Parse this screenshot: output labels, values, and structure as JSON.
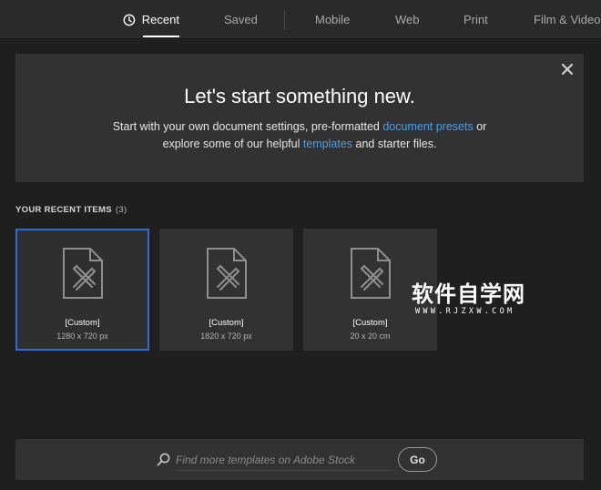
{
  "tabs": {
    "recent": "Recent",
    "saved": "Saved",
    "mobile": "Mobile",
    "web": "Web",
    "print": "Print",
    "film": "Film & Video"
  },
  "hero": {
    "title": "Let's start something new.",
    "line1_prefix": "Start with your own document settings, pre-formatted ",
    "link_presets": "document presets",
    "line1_suffix": " or",
    "line2_prefix": "explore some of our helpful ",
    "link_templates": "templates",
    "line2_suffix": " and starter files."
  },
  "recent": {
    "header": "YOUR RECENT ITEMS",
    "count": "(3)",
    "items": [
      {
        "name": "[Custom]",
        "size": "1280 x 720 px"
      },
      {
        "name": "[Custom]",
        "size": "1820 x 720 px"
      },
      {
        "name": "[Custom]",
        "size": "20 x 20 cm"
      }
    ]
  },
  "watermark": {
    "big": "软件自学网",
    "small": "WWW.RJZXW.COM"
  },
  "search": {
    "placeholder": "Find more templates on Adobe Stock",
    "go_label": "Go"
  },
  "colors": {
    "accent_link": "#4d9fe6",
    "selection": "#2d6ad6",
    "background": "#1f1f1f",
    "panel": "#323232"
  },
  "icons": {
    "recent": "clock-icon",
    "close": "close-icon",
    "document": "document-pencil-icon",
    "search": "search-icon"
  }
}
